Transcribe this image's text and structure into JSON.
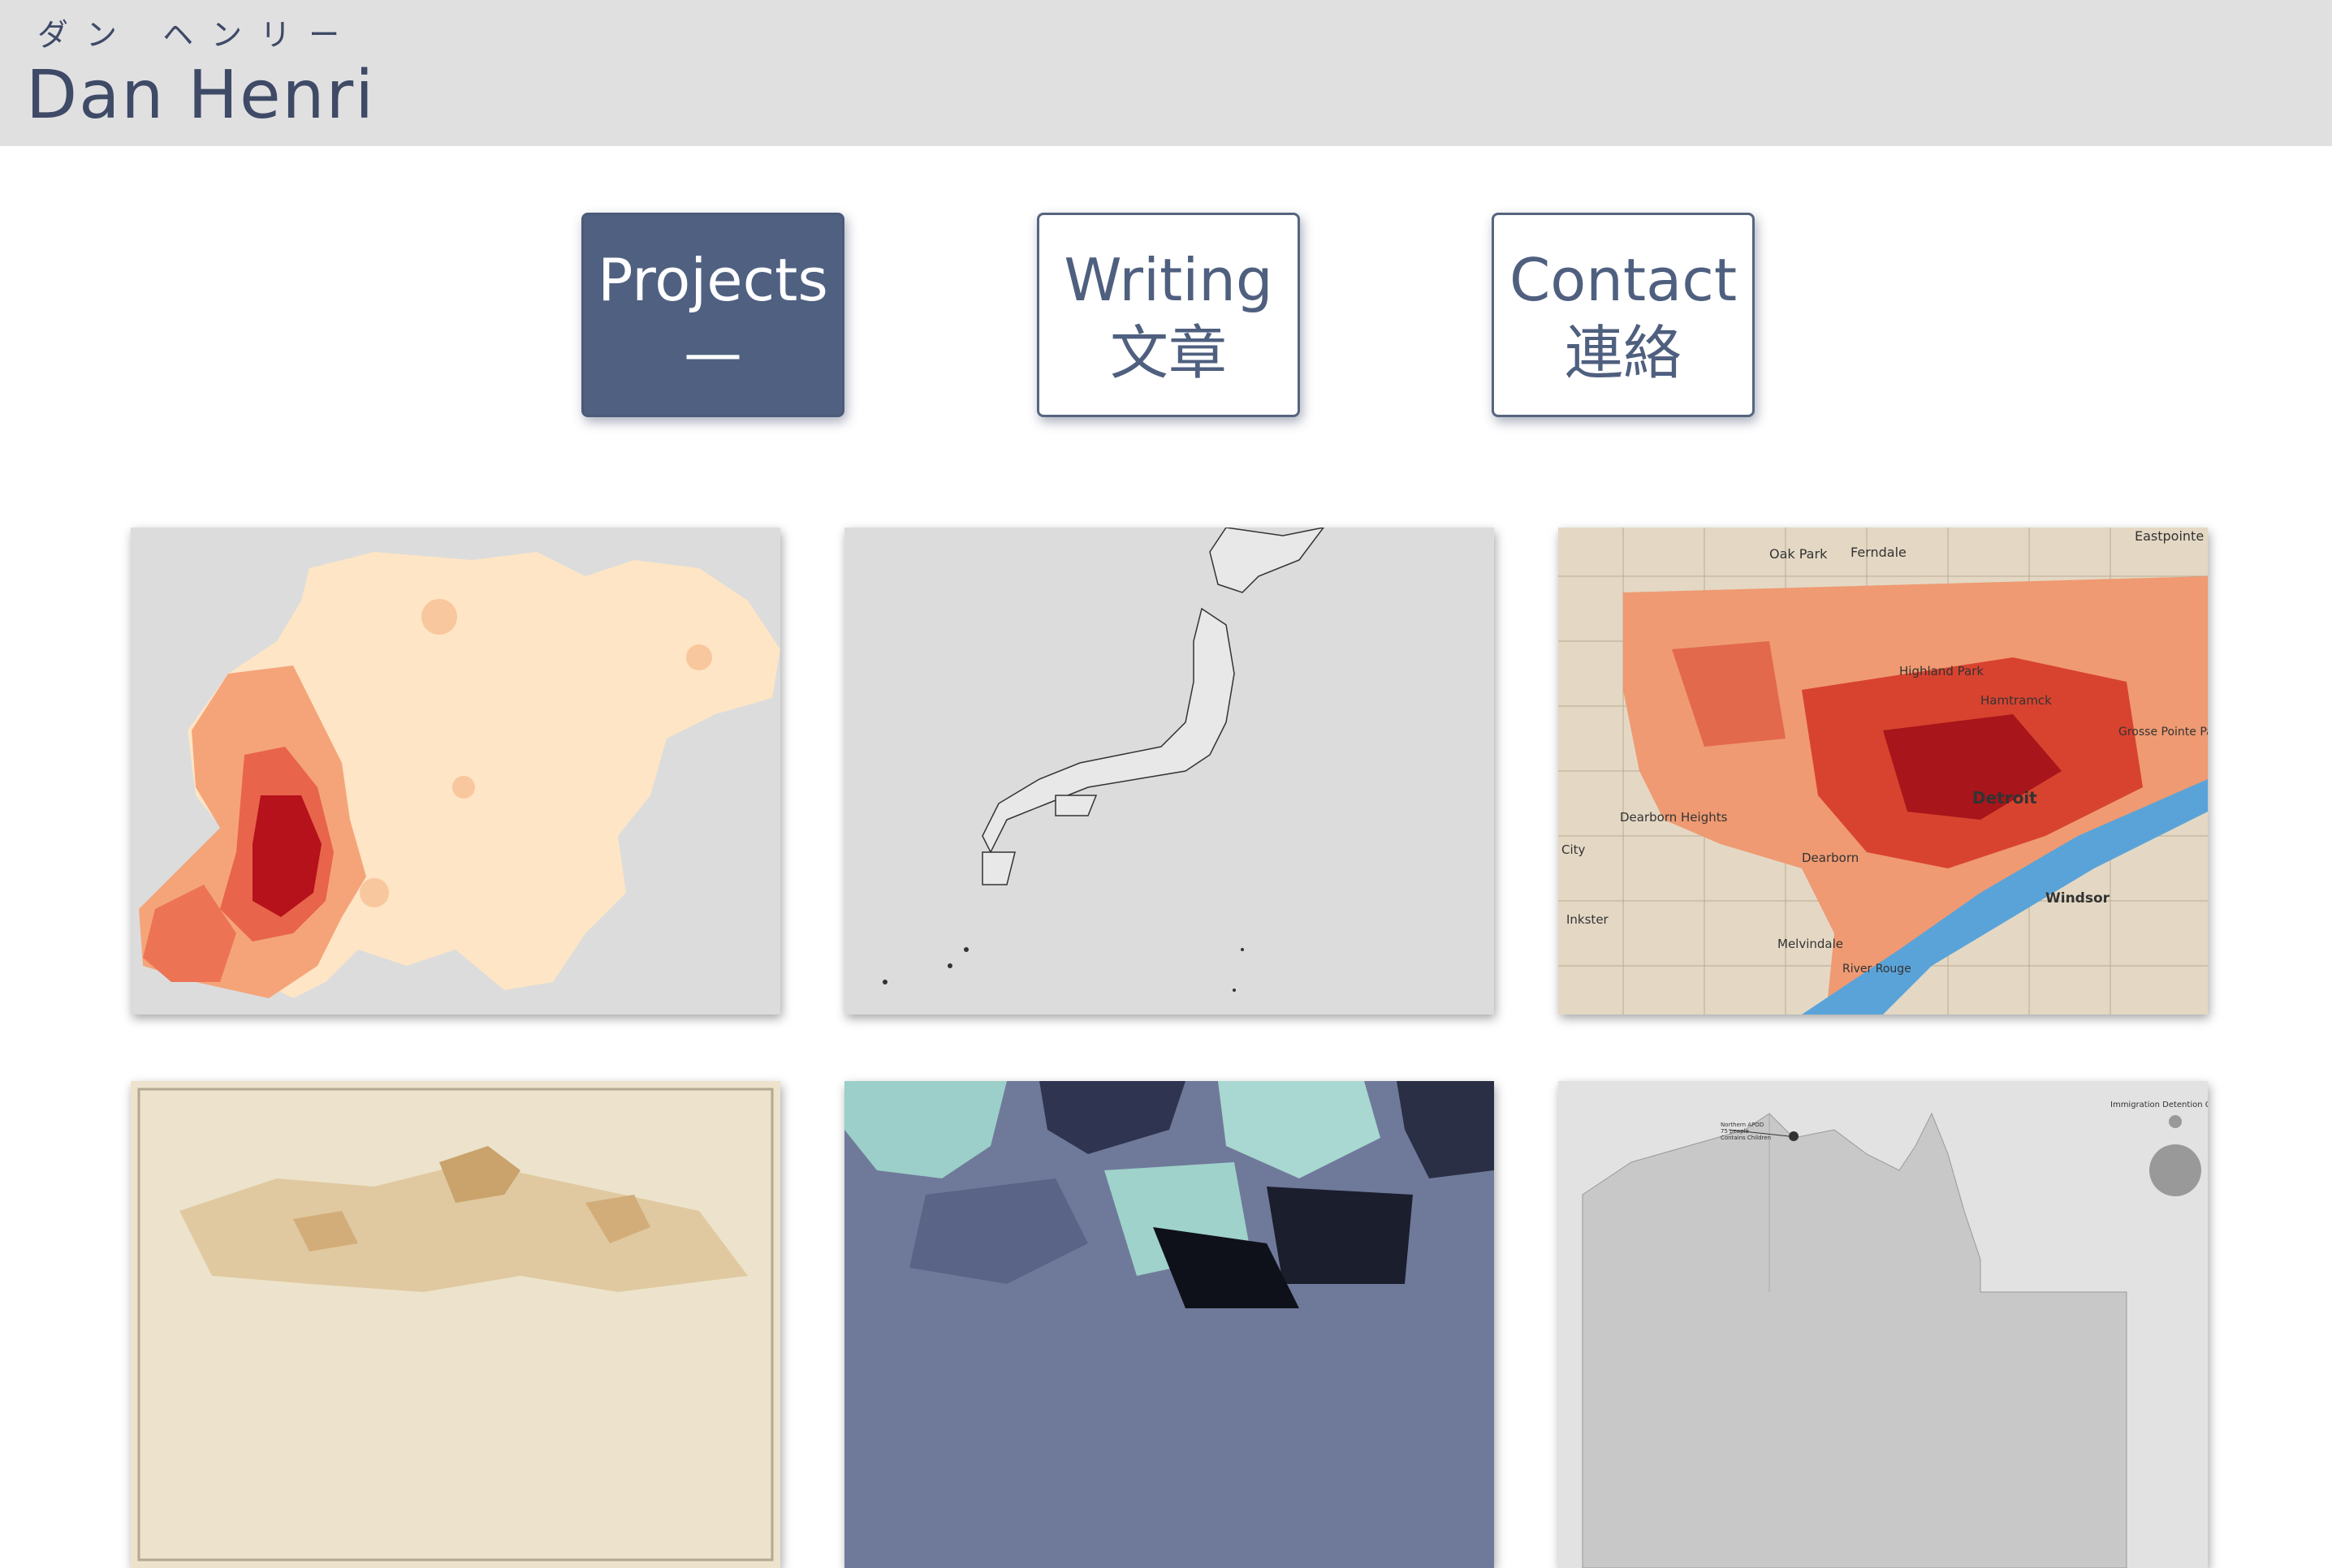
{
  "header": {
    "furigana": "ダン ヘンリー",
    "name": "Dan Henri"
  },
  "nav": [
    {
      "label_en": "Projects",
      "label_ja": "—",
      "active": true
    },
    {
      "label_en": "Writing",
      "label_ja": "文章",
      "active": false
    },
    {
      "label_en": "Contact",
      "label_ja": "連絡",
      "active": false
    }
  ],
  "gallery": {
    "detroit_labels": [
      "Oak Park",
      "Ferndale",
      "Eastpointe",
      "Highland Park",
      "Hamtramck",
      "Detroit",
      "Dearborn Heights",
      "Dearborn",
      "Windsor",
      "Inkster",
      "Melvindale",
      "River Rouge",
      "City",
      "Grosse Pointe Pa"
    ],
    "australia_labels": {
      "legend_title": "Immigration Detention Centr",
      "annotation_1": "Northern APOD",
      "annotation_2": "75 people",
      "annotation_3": "Contains Children"
    }
  },
  "colors": {
    "header_bg": "#e0e0e1",
    "accent": "#4f6080",
    "text": "#3e4a66"
  }
}
